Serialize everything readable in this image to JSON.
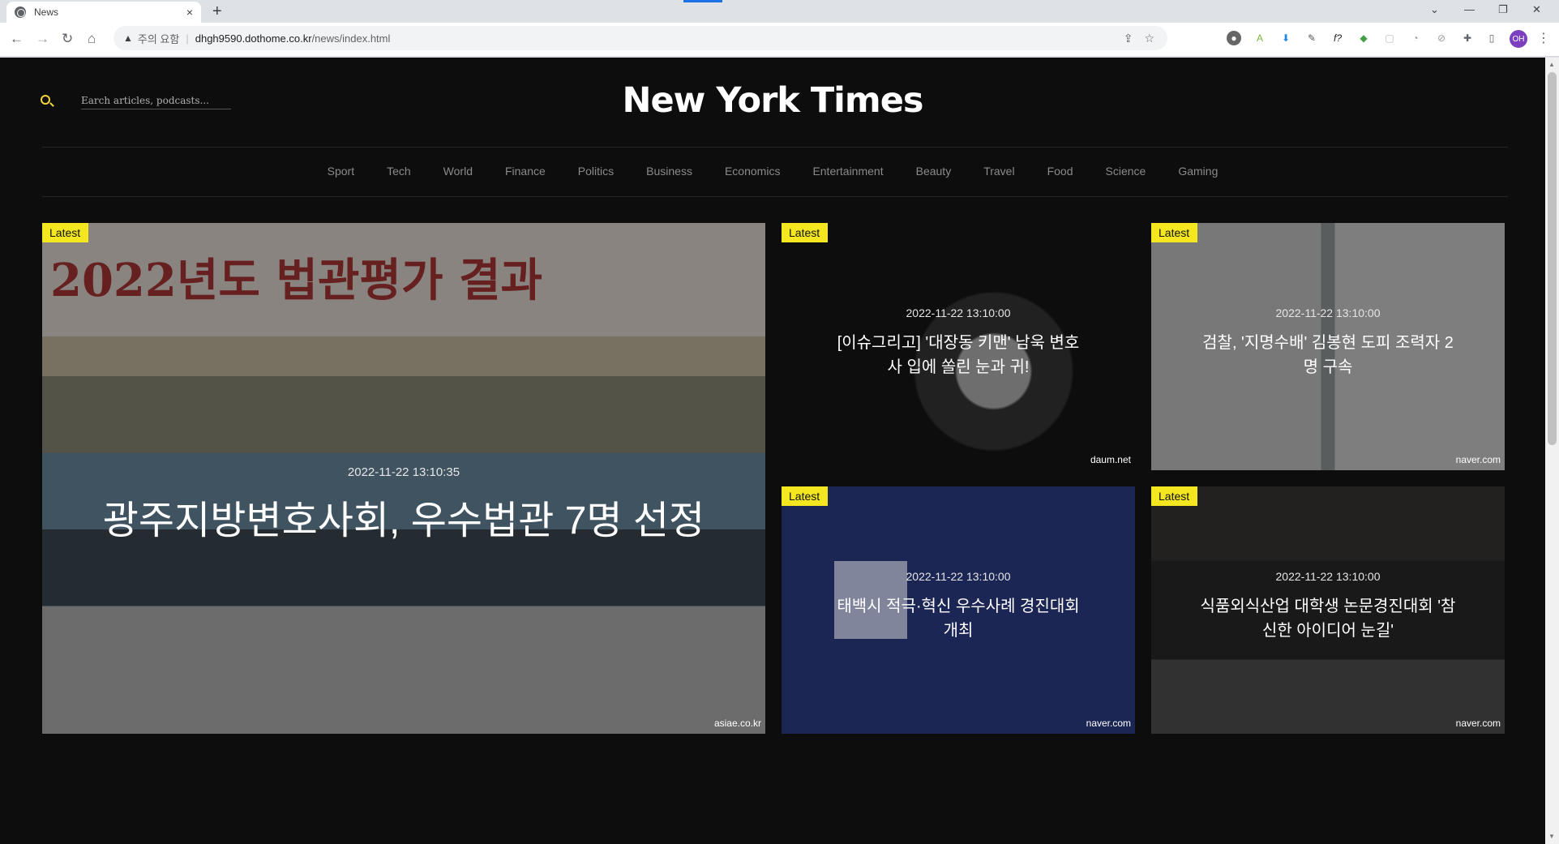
{
  "browser": {
    "tab_title": "News",
    "tab_close": "×",
    "new_tab": "+",
    "security_label": "주의 요함",
    "url_host": "dhgh9590.dothome.co.kr",
    "url_path": "/news/index.html",
    "profile_initials": "OH"
  },
  "site": {
    "title": "New York Times",
    "search_placeholder": "Earch articles, podcasts..."
  },
  "nav": [
    "Sport",
    "Tech",
    "World",
    "Finance",
    "Politics",
    "Business",
    "Economics",
    "Entertainment",
    "Beauty",
    "Travel",
    "Food",
    "Science",
    "Gaming"
  ],
  "featured": {
    "badge": "Latest",
    "date": "2022-11-22 13:10:35",
    "headline": "광주지방변호사회, 우수법관 7명 선정",
    "source": "asiae.co.kr",
    "banner_text": "2022년도 법관평가 결과"
  },
  "cards": [
    {
      "badge": "Latest",
      "date": "2022-11-22 13:10:00",
      "headline": "[이슈그리고] '대장동 키맨' 남욱 변호사 입에 쏠린 눈과 귀!",
      "source": "daum.net"
    },
    {
      "badge": "Latest",
      "date": "2022-11-22 13:10:00",
      "headline": "검찰, '지명수배' 김봉현 도피 조력자 2명 구속",
      "source": "naver.com"
    },
    {
      "badge": "Latest",
      "date": "2022-11-22 13:10:00",
      "headline": "태백시 적극·혁신 우수사례 경진대회 개최",
      "source": "naver.com"
    },
    {
      "badge": "Latest",
      "date": "2022-11-22 13:10:00",
      "headline": "식품외식산업 대학생 논문경진대회 '참신한 아이디어 눈길'",
      "source": "naver.com"
    }
  ],
  "colors": {
    "accent": "#f5e71f",
    "search_icon": "#f5d33b",
    "page_bg": "#0d0d0d"
  }
}
